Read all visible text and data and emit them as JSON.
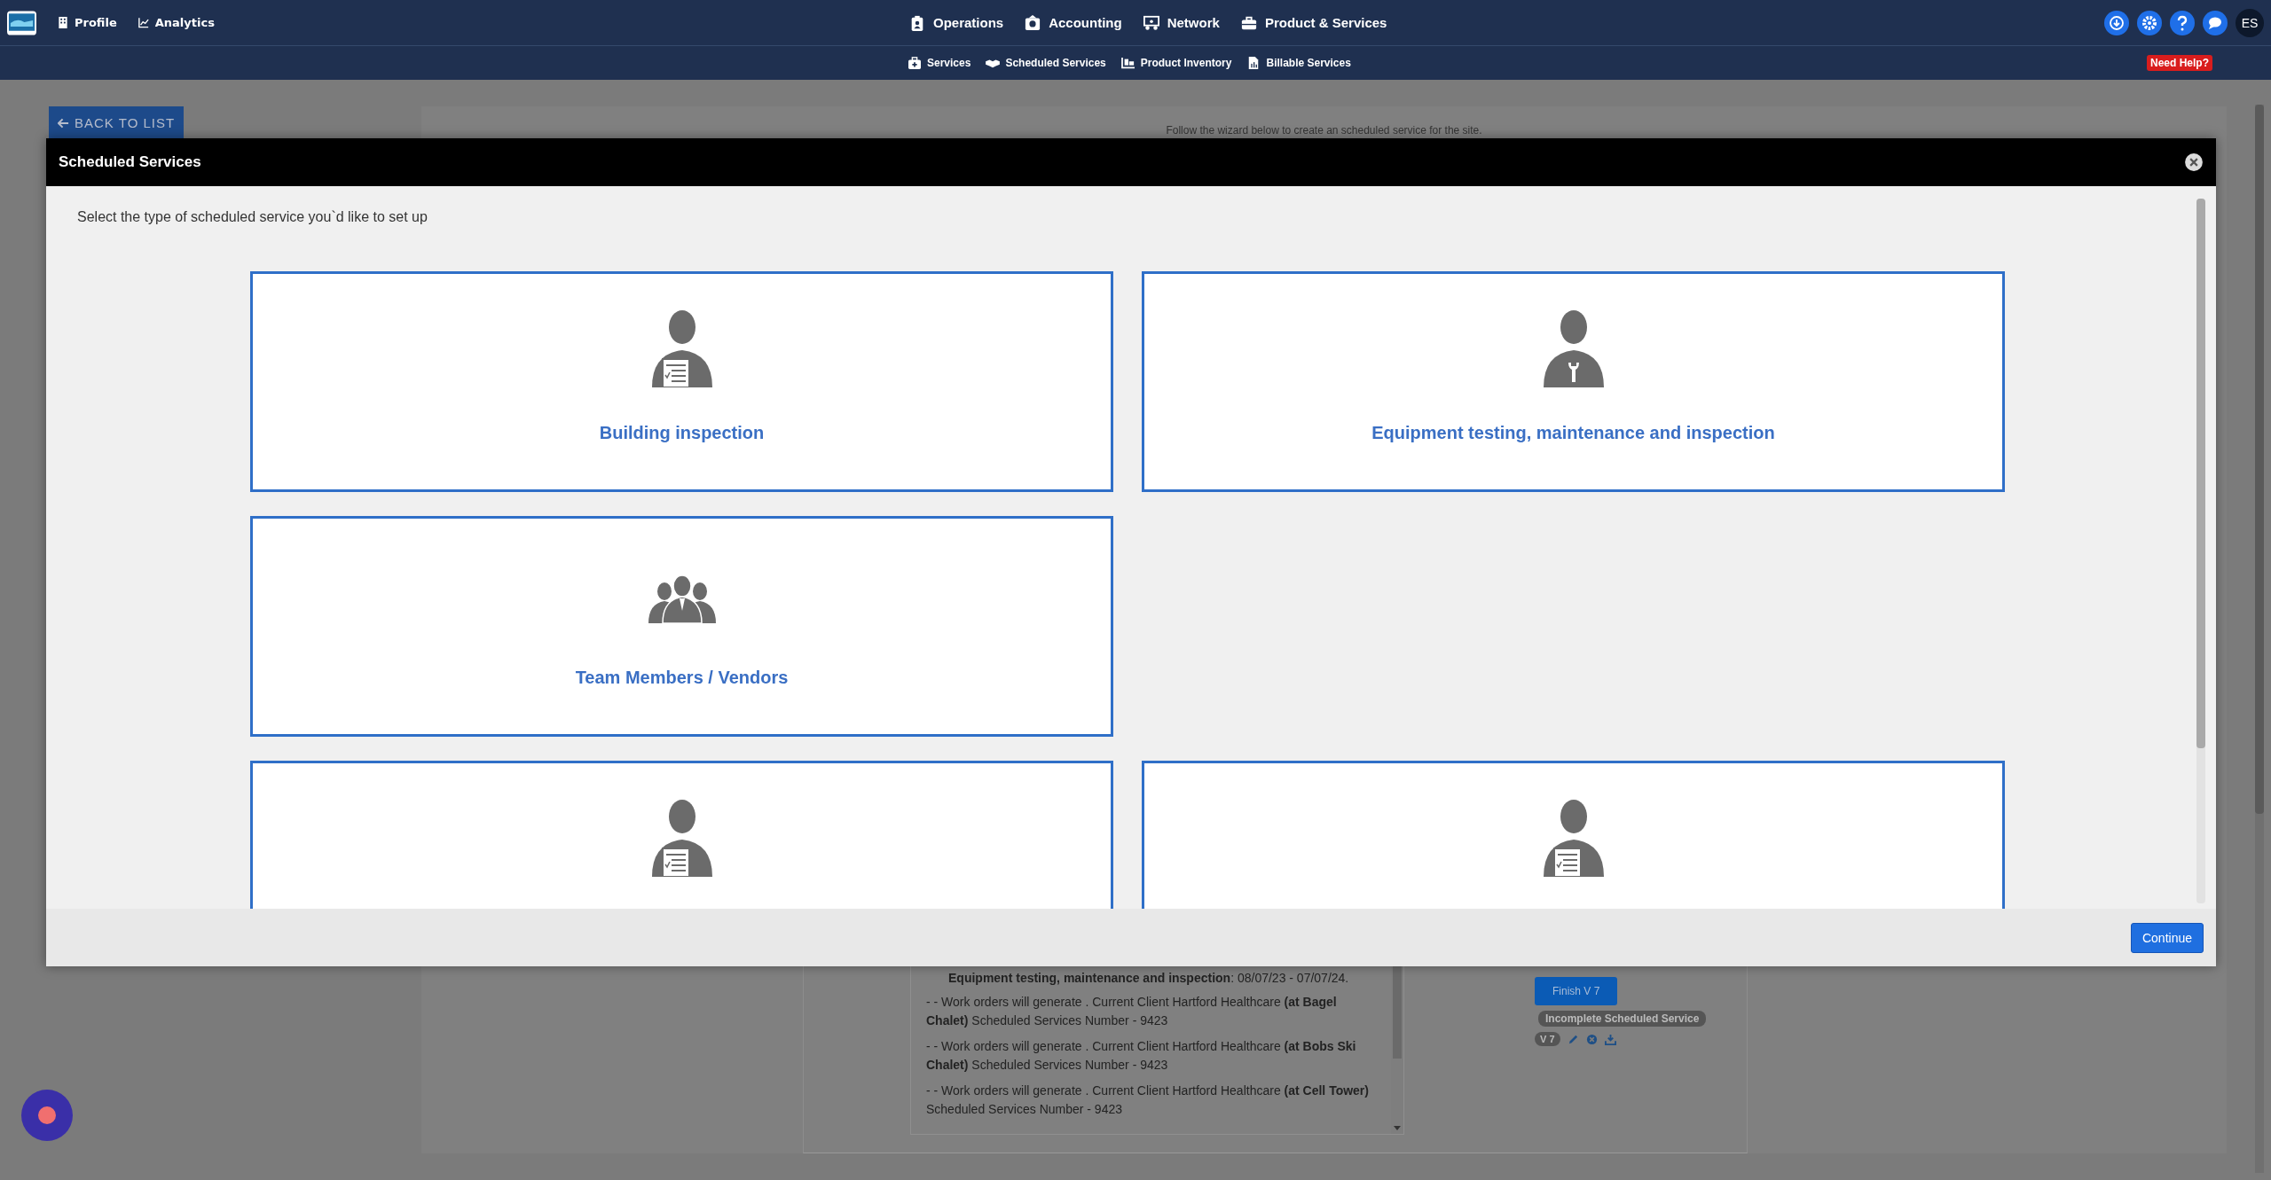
{
  "nav": {
    "left_links": [
      "Profile",
      "Analytics"
    ],
    "main_menu": [
      "Operations",
      "Accounting",
      "Network",
      "Product & Services"
    ],
    "avatar": "ES",
    "sub_menu": [
      "Services",
      "Scheduled Services",
      "Product Inventory",
      "Billable Services"
    ],
    "need_help": "Need Help?"
  },
  "background": {
    "back_button": "BACK TO LIST",
    "intro": "Follow the wizard below to create an scheduled service for the site.",
    "list_header": "**Equipment testing, maintenance and inspection**: 08/07/23 - 07/07/24.",
    "list_items": [
      "- - Work orders will generate . Current Client Hartford Healthcare **(at Bagel Chalet)** Scheduled Services Number - 9423",
      "- - Work orders will generate . Current Client Hartford Healthcare **(at Bobs Ski Chalet)** Scheduled Services Number - 9423",
      "- - Work orders will generate . Current Client Hartford Healthcare **(at Cell Tower)** Scheduled Services Number - 9423"
    ],
    "finish_button": "Finish V 7",
    "status_badge": "Incomplete Scheduled Service",
    "version_badge": "V 7"
  },
  "modal": {
    "title": "Scheduled Services",
    "prompt": "Select the type of scheduled service you`d like to set up",
    "cards": [
      {
        "kind": "clipboard",
        "title": "Building inspection"
      },
      {
        "kind": "wrench",
        "title": "Equipment testing, maintenance and inspection"
      },
      {
        "kind": "group",
        "title": "Team Members / Vendors"
      },
      {
        "kind": "empty"
      },
      {
        "kind": "clipboard"
      },
      {
        "kind": "clipboard"
      }
    ],
    "continue_button": "Continue"
  }
}
